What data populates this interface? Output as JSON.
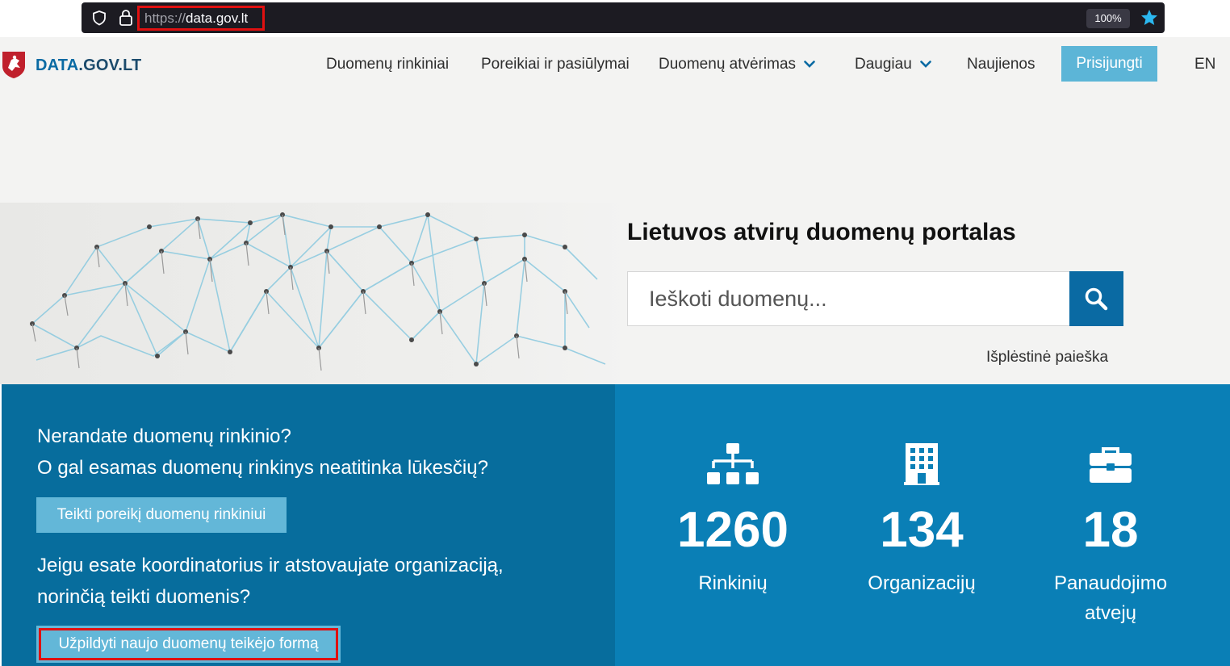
{
  "browser": {
    "url_scheme": "https://",
    "url_host": "data.gov.lt",
    "zoom": "100%",
    "icons": [
      "shield-icon",
      "lock-icon",
      "bookmark-star-icon"
    ]
  },
  "header": {
    "logo_part1": "DATA",
    "logo_part2": ".GOV.LT",
    "nav": {
      "datasets": "Duomenų rinkiniai",
      "requests": "Poreikiai ir pasiūlymai",
      "opening": "Duomenų atvėrimas",
      "more": "Daugiau",
      "news": "Naujienos"
    },
    "login": "Prisijungti",
    "lang": "EN"
  },
  "hero": {
    "title": "Lietuvos atvirų duomenų portalas",
    "search_placeholder": "Ieškoti duomenų...",
    "advanced_search": "Išplėstinė paieška"
  },
  "left_panel": {
    "question_line1": "Nerandate duomenų rinkinio?",
    "question_line2": "O gal esamas duomenų rinkinys neatitinka lūkesčių?",
    "request_button": "Teikti poreikį duomenų rinkiniui",
    "coordinator_line1": "Jeigu esate koordinatorius ir atstovaujate organizaciją,",
    "coordinator_line2": "norinčią teikti duomenis?",
    "provider_button": "Užpildyti naujo duomenų teikėjo formą"
  },
  "stats": [
    {
      "icon": "sitemap-icon",
      "value": "1260",
      "label_line1": "Rinkinių",
      "label_line2": ""
    },
    {
      "icon": "building-icon",
      "value": "134",
      "label_line1": "Organizacijų",
      "label_line2": ""
    },
    {
      "icon": "briefcase-icon",
      "value": "18",
      "label_line1": "Panaudojimo",
      "label_line2": "atvejų"
    }
  ],
  "colors": {
    "brand_dark": "#076d9d",
    "brand": "#0a7fb6",
    "button_light": "#5cb5d7",
    "highlight": "#e01010"
  }
}
